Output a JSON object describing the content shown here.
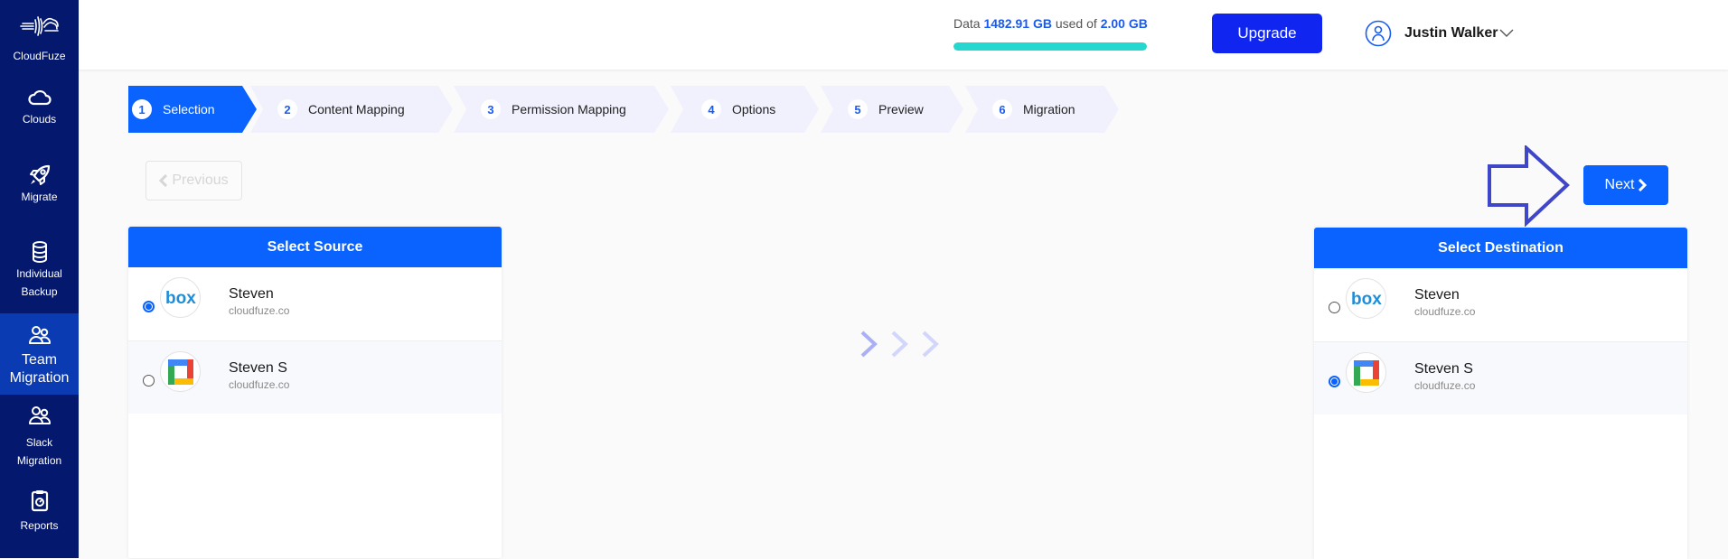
{
  "sidebar": {
    "brand": {
      "label": "CloudFuze",
      "icon": "cloudfuze-logo-icon"
    },
    "items": [
      {
        "label": "Clouds",
        "icon": "cloud-icon",
        "active": false
      },
      {
        "label": "Migrate",
        "icon": "rocket-icon",
        "active": false
      },
      {
        "label_line1": "Individual",
        "label_line2": "Backup",
        "icon": "database-icon",
        "active": false
      },
      {
        "label_line1": "Team",
        "label_line2": "Migration",
        "icon": "users-icon",
        "active": true
      },
      {
        "label_line1": "Slack",
        "label_line2": "Migration",
        "icon": "users-icon",
        "active": false
      },
      {
        "label": "Reports",
        "icon": "clipboard-report-icon",
        "active": false
      }
    ]
  },
  "header": {
    "usage": {
      "prefix": "Data",
      "used": "1482.91 GB",
      "middle": "used of",
      "total": "2.00 GB",
      "progress_percent": 100,
      "bar_color": "#24d8cf"
    },
    "upgrade_label": "Upgrade",
    "user": {
      "name": "Justin Walker",
      "icon": "user-avatar-icon"
    }
  },
  "stepper": {
    "steps": [
      {
        "number": "1",
        "label": "Selection",
        "active": true
      },
      {
        "number": "2",
        "label": "Content Mapping",
        "active": false
      },
      {
        "number": "3",
        "label": "Permission Mapping",
        "active": false
      },
      {
        "number": "4",
        "label": "Options",
        "active": false
      },
      {
        "number": "5",
        "label": "Preview",
        "active": false
      },
      {
        "number": "6",
        "label": "Migration",
        "active": false
      }
    ]
  },
  "nav": {
    "previous_label": "Previous",
    "next_label": "Next"
  },
  "source": {
    "title": "Select Source",
    "accounts": [
      {
        "name": "Steven",
        "domain": "cloudfuze.co",
        "provider": "box",
        "selected": true
      },
      {
        "name": "Steven S",
        "domain": "cloudfuze.co",
        "provider": "google-workspace",
        "selected": false
      }
    ]
  },
  "destination": {
    "title": "Select Destination",
    "accounts": [
      {
        "name": "Steven",
        "domain": "cloudfuze.co",
        "provider": "box",
        "selected": false
      },
      {
        "name": "Steven S",
        "domain": "cloudfuze.co",
        "provider": "google-workspace",
        "selected": true
      }
    ]
  },
  "colors": {
    "sidebar_bg": "#04186d",
    "sidebar_active": "#0b3bb3",
    "primary": "#0a63ff",
    "upgrade": "#1026f0",
    "step_inactive": "#f0f1fd",
    "hint_arrow": "#4046c8"
  }
}
